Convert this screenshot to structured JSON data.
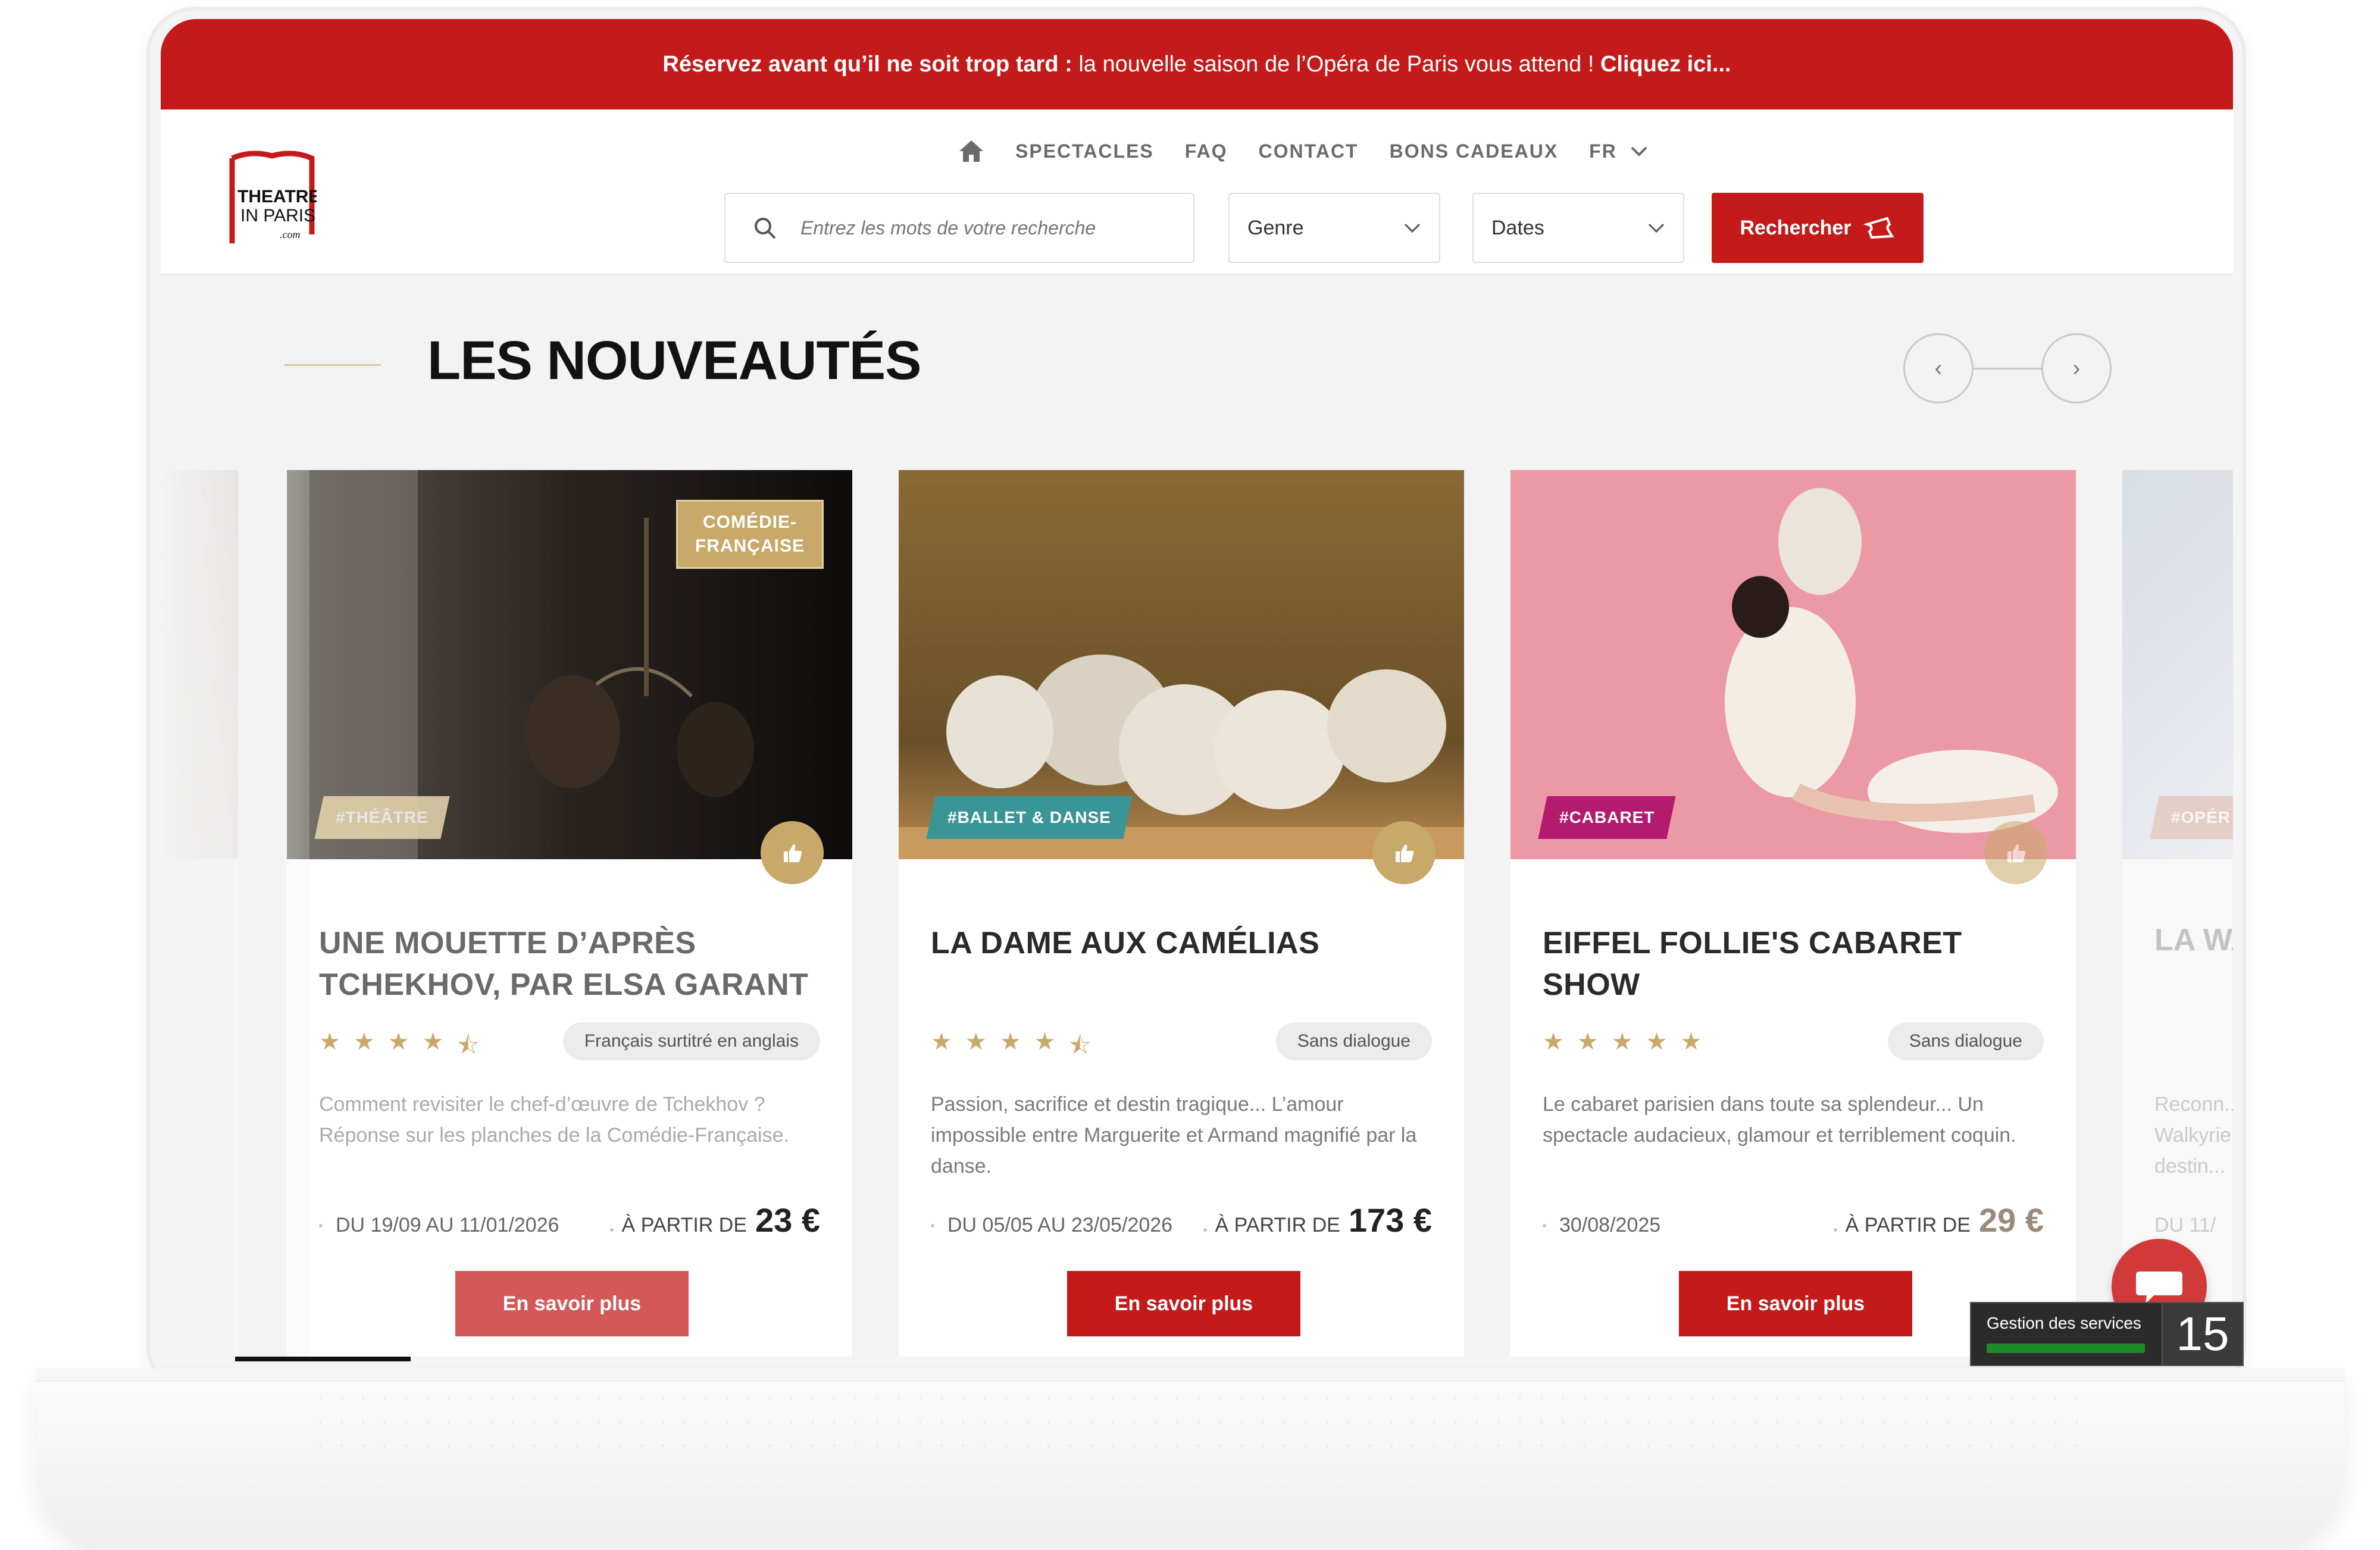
{
  "banner": {
    "bold_text": "Réservez avant qu’il ne soit trop tard :",
    "text": " la nouvelle saison de l’Opéra de Paris vous attend ! ",
    "link": "Cliquez ici..."
  },
  "logo": {
    "line1": "THEATRE",
    "line2": "IN PARIS",
    "line3": ".com"
  },
  "nav": {
    "home_icon": "home-icon",
    "items": [
      "SPECTACLES",
      "FAQ",
      "CONTACT",
      "BONS CADEAUX"
    ],
    "lang": "FR"
  },
  "search": {
    "placeholder": "Entrez les mots de votre recherche",
    "genre": "Genre",
    "dates": "Dates",
    "button": "Rechercher"
  },
  "section": {
    "title": "LES NOUVEAUTÉS"
  },
  "cards": [
    {
      "badge": "COMÉDIE-\nFRANÇAISE",
      "genre": "#THÉÂTRE",
      "genre_color": "#c9a96a",
      "title": "UNE MOUETTE D’APRÈS TCHEKHOV, PAR ELSA GARANT",
      "rating": 4.5,
      "lang": "Français surtitré en anglais",
      "desc": "Comment revisiter le chef-d’œuvre de Tchekhov ? Réponse sur les planches de la Comédie-Française.",
      "dates": "DU 19/09 AU 11/01/2026",
      "price_label": "À PARTIR DE",
      "price": "23 €",
      "button": "En savoir plus"
    },
    {
      "badge": "",
      "genre": "#BALLET & DANSE",
      "genre_color": "#3a9696",
      "title": "LA DAME AUX CAMÉLIAS",
      "rating": 4.5,
      "lang": "Sans dialogue",
      "desc": "Passion, sacrifice et destin tragique... L’amour impossible entre Marguerite et Armand magnifié par la danse.",
      "dates": "DU 05/05 AU 23/05/2026",
      "price_label": "À PARTIR DE",
      "price": "173 €",
      "button": "En savoir plus"
    },
    {
      "badge": "",
      "genre": "#CABARET",
      "genre_color": "#b41a6e",
      "title": "EIFFEL FOLLIE'S CABARET SHOW",
      "rating": 5,
      "lang": "Sans dialogue",
      "desc": "Le cabaret parisien dans toute sa splendeur... Un spectacle audacieux, glamour et terriblement coquin.",
      "dates": "30/08/2025",
      "price_label": "À PARTIR DE",
      "price": "29 €",
      "button": "En savoir plus"
    }
  ],
  "peek_card": {
    "genre": "#OPÉR",
    "title": "LA WA",
    "desc": "Reconn... Walkyrie destin...",
    "dates": "DU 11/"
  },
  "widget": {
    "label": "Gestion des services",
    "count": "15"
  },
  "colors": {
    "brand_red": "#c41a1a",
    "gold": "#c9a96a"
  }
}
